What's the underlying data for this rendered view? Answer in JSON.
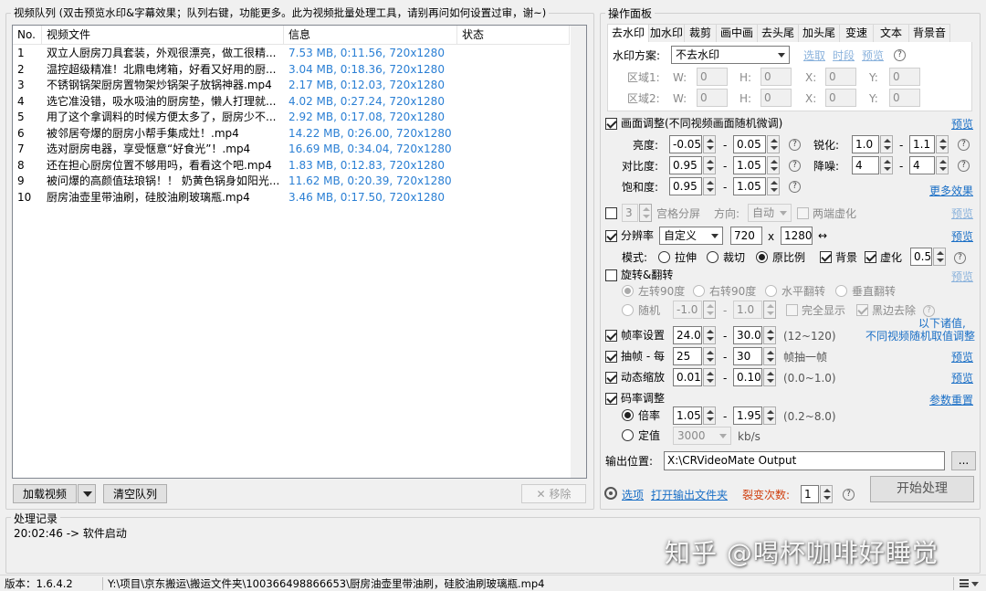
{
  "queue": {
    "title": "视频队列 (双击预览水印&字幕效果；队列右键，功能更多。此为视频批量处理工具，请别再问如何设置过审，谢~)",
    "columns": [
      "No.",
      "视频文件",
      "信息",
      "状态"
    ],
    "rows": [
      {
        "no": "1",
        "file": "双立人厨房刀具套装，外观很漂亮，做工很精...",
        "info": "7.53 MB, 0:11.56, 720x1280",
        "status": ""
      },
      {
        "no": "2",
        "file": "温控超级精准！北鼎电烤箱，好看又好用的厨...",
        "info": "3.04 MB, 0:18.36, 720x1280",
        "status": ""
      },
      {
        "no": "3",
        "file": "不锈钢锅架厨房置物架炒锅架子放锅神器.mp4",
        "info": "2.17 MB, 0:12.03, 720x1280",
        "status": ""
      },
      {
        "no": "4",
        "file": "选它准没错，吸水吸油的厨房垫，懒人打理就...",
        "info": "4.02 MB, 0:27.24, 720x1280",
        "status": ""
      },
      {
        "no": "5",
        "file": "用了这个拿调料的时候方便太多了，厨房少不...",
        "info": "2.92 MB, 0:17.08, 720x1280",
        "status": ""
      },
      {
        "no": "6",
        "file": "被邻居夸爆的厨房小帮手集成灶！.mp4",
        "info": "14.22 MB, 0:26.00, 720x1280",
        "status": ""
      },
      {
        "no": "7",
        "file": "选对厨房电器，享受惬意“好食光”！.mp4",
        "info": "16.69 MB, 0:34.04, 720x1280",
        "status": ""
      },
      {
        "no": "8",
        "file": "还在担心厨房位置不够用吗，看看这个吧.mp4",
        "info": "1.83 MB, 0:12.83, 720x1280",
        "status": ""
      },
      {
        "no": "9",
        "file": "被问爆的高颜值珐琅锅！！ 奶黄色锅身如阳光...",
        "info": "11.62 MB, 0:20.39, 720x1280",
        "status": ""
      },
      {
        "no": "10",
        "file": "厨房油壶里带油刷，硅胶油刷玻璃瓶.mp4",
        "info": "3.46 MB, 0:17.50, 720x1280",
        "status": ""
      }
    ],
    "load_button": "加载视频",
    "clear_button": "清空队列",
    "remove_button": "移除"
  },
  "panel": {
    "title": "操作面板",
    "tabs": [
      "去水印",
      "加水印",
      "裁剪",
      "画中画",
      "去头尾",
      "加头尾",
      "变速",
      "文本",
      "背景音"
    ],
    "active_tab": 0,
    "watermark": {
      "scheme_label": "水印方案:",
      "scheme_value": "不去水印",
      "select_link": "选取",
      "time_link": "时段",
      "preview_link": "预览",
      "area1_label": "区域1:",
      "area2_label": "区域2:",
      "w": "W:",
      "h": "H:",
      "x": "X:",
      "y": "Y:",
      "zero": "0"
    },
    "picture": {
      "label": "画面调整(不同视频画面随机微调)",
      "preview": "预览",
      "brightness_label": "亮度:",
      "brightness_min": "-0.05",
      "brightness_max": "0.05",
      "sharpen_label": "锐化:",
      "sharpen_min": "1.0",
      "sharpen_max": "1.1",
      "contrast_label": "对比度:",
      "contrast_min": "0.95",
      "contrast_max": "1.05",
      "denoise_label": "降噪:",
      "denoise_min": "4",
      "denoise_max": "4",
      "saturation_label": "饱和度:",
      "saturation_min": "0.95",
      "saturation_max": "1.05",
      "more_effects": "更多效果",
      "dash": "-"
    },
    "grid": {
      "count": "3",
      "label": "宫格分屏",
      "direction_label": "方向:",
      "direction_value": "自动",
      "blur_label": "两端虚化",
      "preview": "预览"
    },
    "resolution": {
      "label": "分辨率",
      "mode_value": "自定义",
      "width": "720",
      "x": "x",
      "height": "1280",
      "swap": "↔",
      "preview": "预览",
      "mode_label": "模式:",
      "stretch": "拉伸",
      "crop": "裁切",
      "ratio": "原比例",
      "background": "背景",
      "blur": "虚化",
      "blur_value": "0.5"
    },
    "rotate": {
      "label": "旋转&翻转",
      "preview": "预览",
      "left90": "左转90度",
      "right90": "右转90度",
      "hflip": "水平翻转",
      "vflip": "垂直翻转",
      "random": "随机",
      "rand_min": "-1.0",
      "rand_max": "1.0",
      "full": "完全显示",
      "black_border": "黑边去除"
    },
    "random_note_1": "以下诸值,",
    "random_note_2": "不同视频随机取值调整",
    "fps": {
      "label": "帧率设置",
      "min": "24.0",
      "max": "30.0",
      "range": "(12~120)"
    },
    "frame_drop": {
      "label": "抽帧 - 每",
      "min": "25",
      "max": "30",
      "suffix": "帧抽一帧",
      "preview": "预览"
    },
    "zoom": {
      "label": "动态缩放",
      "min": "0.01",
      "max": "0.10",
      "range": "(0.0~1.0)",
      "preview": "预览"
    },
    "bitrate": {
      "label": "码率调整",
      "reset": "参数重置",
      "multiplier": "倍率",
      "mult_min": "1.05",
      "mult_max": "1.95",
      "mult_range": "(0.2~8.0)",
      "fixed": "定值",
      "fixed_value": "3000",
      "unit": "kb/s"
    },
    "output_label": "输出位置:",
    "output_path": "X:\\CRVideoMate Output",
    "browse": "...",
    "options_link": "选项",
    "open_folder_link": "打开输出文件夹",
    "split_label": "裂变次数:",
    "split_value": "1",
    "start_button": "开始处理"
  },
  "log": {
    "title": "处理记录",
    "lines": [
      "20:02:46 -> 软件启动"
    ]
  },
  "watermark_text": "知乎 @喝杯咖啡好睡觉",
  "status": {
    "version": "版本：1.6.4.2",
    "path": "Y:\\项目\\京东搬运\\搬运文件夹\\100366498866653\\厨房油壶里带油刷，硅胶油刷玻璃瓶.mp4"
  },
  "help_char": "?",
  "colors": {
    "info_blue": "#2a7fd4",
    "link_blue": "#1a6fc6",
    "split_red": "#d04010"
  }
}
